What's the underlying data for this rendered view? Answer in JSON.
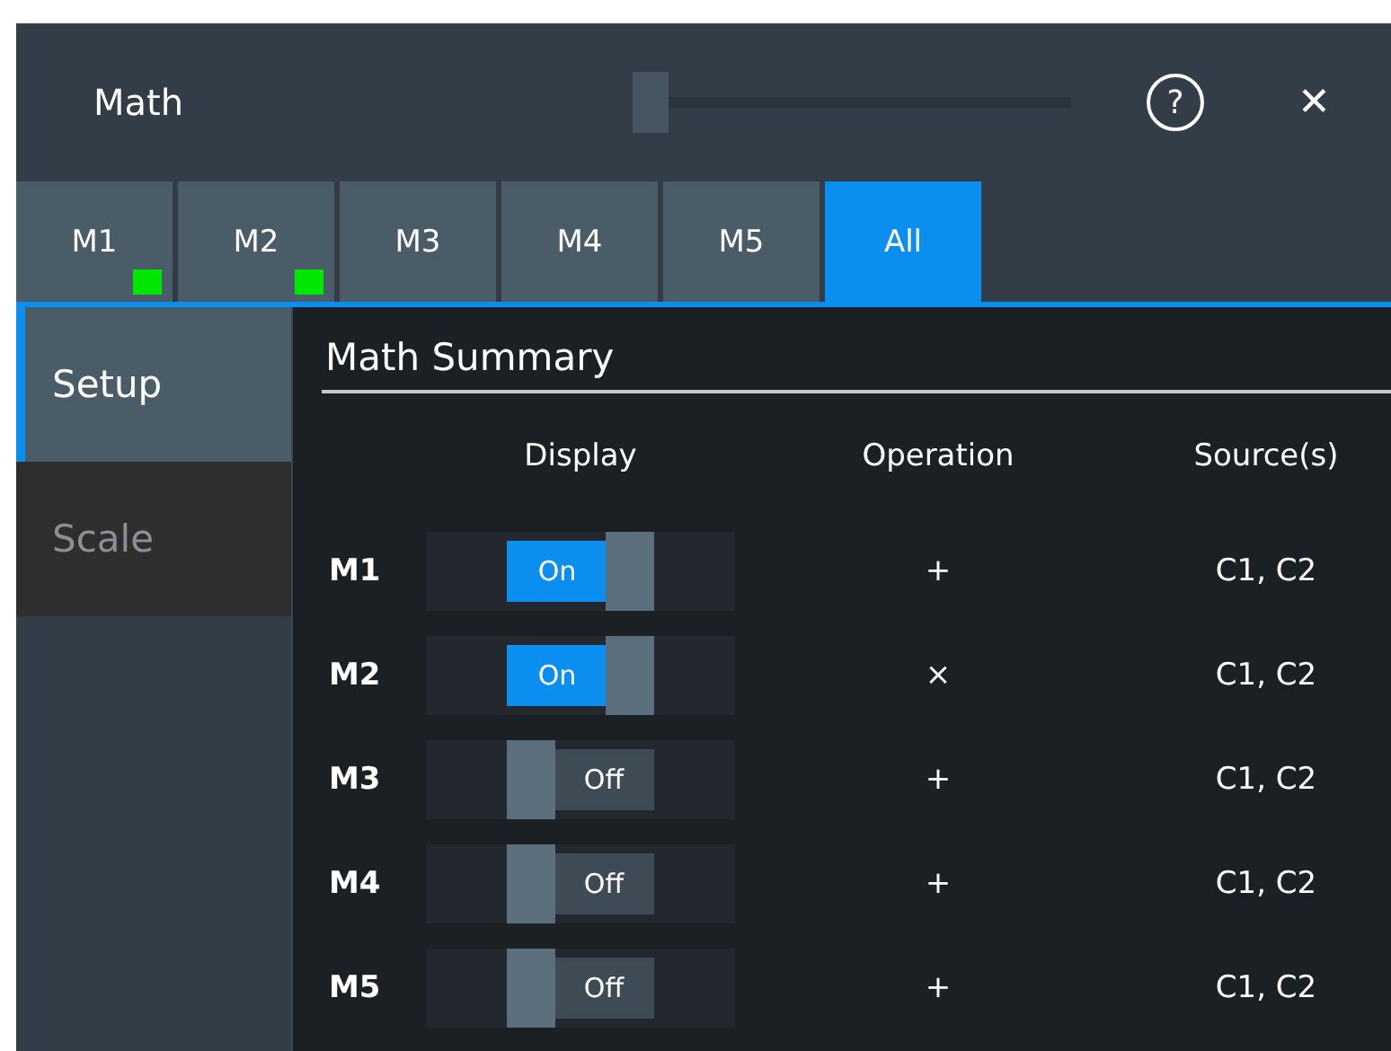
{
  "window": {
    "title": "Math",
    "slider": {
      "level": 0
    },
    "help": "?",
    "close": "✕"
  },
  "tabs": [
    {
      "label": "M1",
      "selected": false,
      "active": true
    },
    {
      "label": "M2",
      "selected": false,
      "active": true
    },
    {
      "label": "M3",
      "selected": false,
      "active": false
    },
    {
      "label": "M4",
      "selected": false,
      "active": false
    },
    {
      "label": "M5",
      "selected": false,
      "active": false
    },
    {
      "label": "All",
      "selected": true,
      "active": false
    }
  ],
  "sidebar": {
    "items": [
      {
        "label": "Setup",
        "selected": true
      },
      {
        "label": "Scale",
        "selected": false
      }
    ]
  },
  "summary": {
    "title": "Math Summary",
    "columns": [
      "Display",
      "Operation",
      "Source(s)"
    ],
    "rows": [
      {
        "name": "M1",
        "on": true,
        "toggle": "On",
        "operation": "+",
        "sources": "C1, C2"
      },
      {
        "name": "M2",
        "on": true,
        "toggle": "On",
        "operation": "×",
        "sources": "C1, C2"
      },
      {
        "name": "M3",
        "on": false,
        "toggle": "Off",
        "operation": "+",
        "sources": "C1, C2"
      },
      {
        "name": "M4",
        "on": false,
        "toggle": "Off",
        "operation": "+",
        "sources": "C1, C2"
      },
      {
        "name": "M5",
        "on": false,
        "toggle": "Off",
        "operation": "+",
        "sources": "C1, C2"
      }
    ]
  }
}
